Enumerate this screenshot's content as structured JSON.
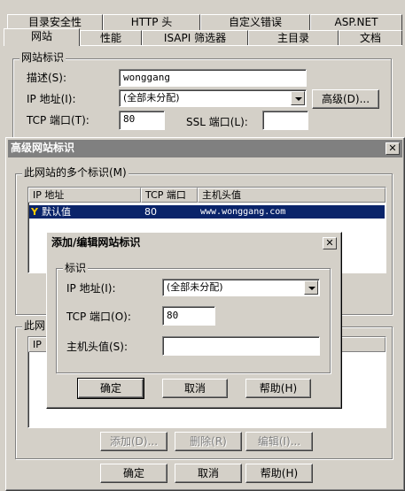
{
  "main_dialog": {
    "tabs_row1": [
      "目录安全性",
      "HTTP 头",
      "自定义错误",
      "ASP.NET"
    ],
    "tabs_row2": [
      "网站",
      "性能",
      "ISAPI 筛选器",
      "主目录",
      "文档"
    ],
    "site_id_group": "网站标识",
    "desc_label": "描述(S):",
    "desc_value": "wonggang",
    "ip_label": "IP 地址(I):",
    "ip_value": "(全部未分配)",
    "advanced_button": "高级(D)...",
    "tcp_label": "TCP 端口(T):",
    "tcp_value": "80",
    "ssl_label": "SSL 端口(L):",
    "ssl_value": ""
  },
  "advanced_dialog": {
    "title": "高级网站标识",
    "multi_group": "此网站的多个标识(M)",
    "columns": [
      "IP 地址",
      "TCP 端口",
      "主机头值"
    ],
    "rows": [
      {
        "ip": "默认值",
        "port": "80",
        "host": "www.wonggang.com"
      }
    ],
    "second_group_partial": "此网",
    "second_header_partial": "IP",
    "add_button": "添加(D)...",
    "remove_button": "删除(R)",
    "edit_button": "编辑(I)...",
    "ok_button": "确定",
    "cancel_button": "取消",
    "help_button": "帮助(H)"
  },
  "edit_dialog": {
    "title": "添加/编辑网站标识",
    "group": "标识",
    "ip_label": "IP 地址(I):",
    "ip_value": "(全部未分配)",
    "tcp_label": "TCP 端口(O):",
    "tcp_value": "80",
    "host_label": "主机头值(S):",
    "host_value": "",
    "ok_button": "确定",
    "cancel_button": "取消",
    "help_button": "帮助(H)"
  },
  "colors": {
    "face": "#d4d0c8",
    "selection": "#0a246a",
    "inactive_title": "#808080"
  }
}
